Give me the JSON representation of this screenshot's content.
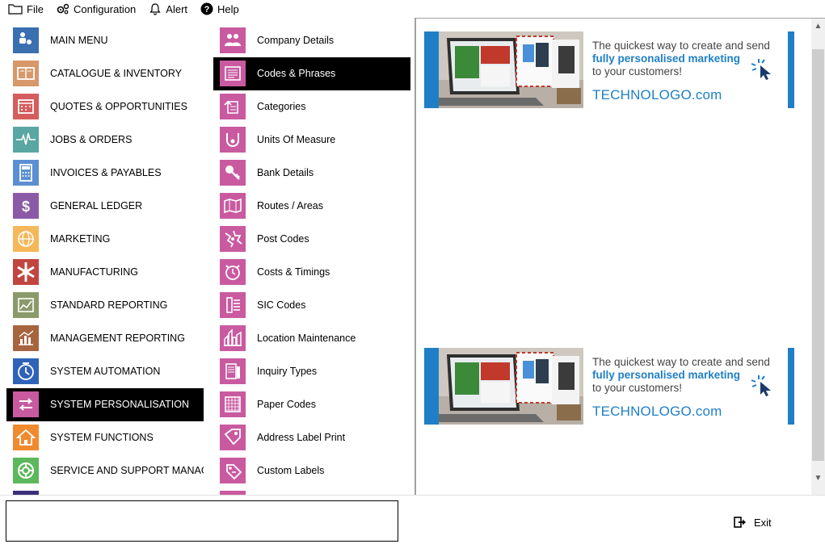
{
  "menubar": {
    "items": [
      {
        "label": "File",
        "icon": "folder-icon"
      },
      {
        "label": "Configuration",
        "icon": "gears-icon"
      },
      {
        "label": "Alert",
        "icon": "bell-icon"
      },
      {
        "label": "Help",
        "icon": "help-icon"
      }
    ]
  },
  "modules": [
    {
      "label": "MAIN MENU",
      "color": "#3a6fb0"
    },
    {
      "label": "CATALOGUE & INVENTORY",
      "color": "#d7986a"
    },
    {
      "label": "QUOTES & OPPORTUNITIES",
      "color": "#d45d5d"
    },
    {
      "label": "JOBS & ORDERS",
      "color": "#5aa6a2"
    },
    {
      "label": "INVOICES & PAYABLES",
      "color": "#5b8fd2"
    },
    {
      "label": "GENERAL LEDGER",
      "color": "#8b5aa6"
    },
    {
      "label": "MARKETING",
      "color": "#f4b75a"
    },
    {
      "label": "MANUFACTURING",
      "color": "#c0463f"
    },
    {
      "label": "STANDARD REPORTING",
      "color": "#8b9a6a"
    },
    {
      "label": "MANAGEMENT REPORTING",
      "color": "#a6653f"
    },
    {
      "label": "SYSTEM AUTOMATION",
      "color": "#2f63b8"
    },
    {
      "label": "SYSTEM PERSONALISATION",
      "color": "#c95aa0"
    },
    {
      "label": "SYSTEM FUNCTIONS",
      "color": "#f08a2e"
    },
    {
      "label": "SERVICE AND SUPPORT MANAGEMENT",
      "color": "#5cb85c"
    }
  ],
  "submenu": [
    {
      "label": "Company Details"
    },
    {
      "label": "Codes & Phrases"
    },
    {
      "label": "Categories"
    },
    {
      "label": "Units Of Measure"
    },
    {
      "label": "Bank Details"
    },
    {
      "label": "Routes / Areas"
    },
    {
      "label": "Post Codes"
    },
    {
      "label": "Costs & Timings"
    },
    {
      "label": "SIC Codes"
    },
    {
      "label": "Location Maintenance"
    },
    {
      "label": "Inquiry Types"
    },
    {
      "label": "Paper Codes"
    },
    {
      "label": "Address Label Print"
    },
    {
      "label": "Custom Labels"
    }
  ],
  "submenu_color": "#c95aa0",
  "selected_module_index": 11,
  "selected_submenu_index": 1,
  "banners": [
    {
      "line1": "The quickest way to create and send",
      "line2": "fully personalised marketing",
      "line3": "to your customers!",
      "brand": "TECHNOLOGO.com"
    },
    {
      "line1": "The quickest way to create and send",
      "line2": "fully personalised marketing",
      "line3": "to your customers!",
      "brand": "TECHNOLOGO.com"
    }
  ],
  "footer": {
    "exit_label": "Exit"
  },
  "accent_color": "#1f7fc6"
}
